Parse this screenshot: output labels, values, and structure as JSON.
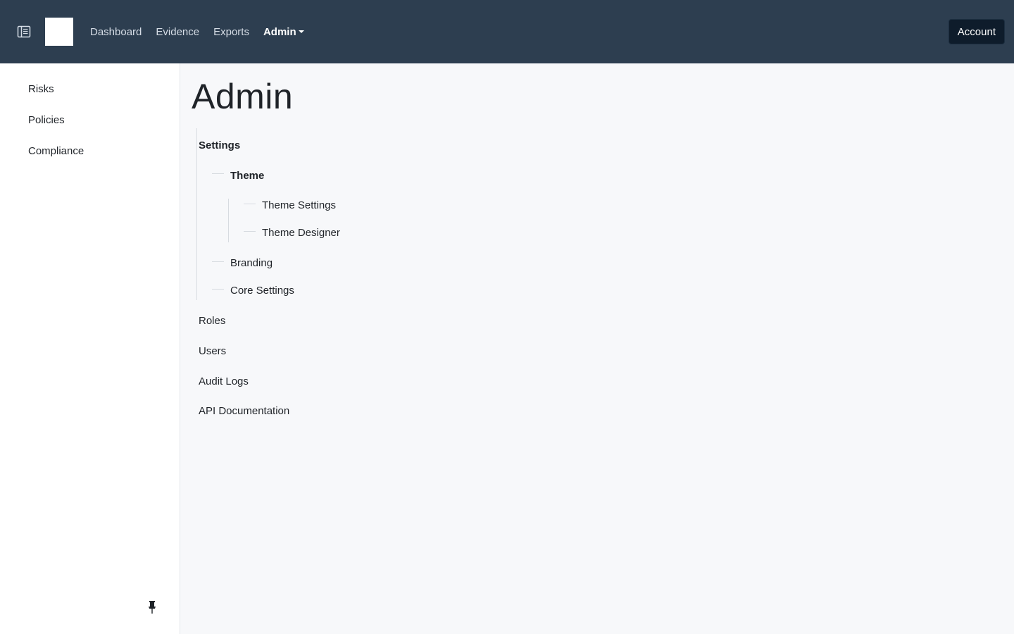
{
  "navbar": {
    "links": [
      {
        "label": "Dashboard"
      },
      {
        "label": "Evidence"
      },
      {
        "label": "Exports"
      },
      {
        "label": "Admin"
      }
    ],
    "account_label": "Account",
    "active_link": "Admin"
  },
  "sidebar": {
    "items": [
      {
        "label": "Risks"
      },
      {
        "label": "Policies"
      },
      {
        "label": "Compliance"
      }
    ]
  },
  "main": {
    "title": "Admin",
    "tree": {
      "settings": "Settings",
      "theme": "Theme",
      "theme_settings": "Theme Settings",
      "theme_designer": "Theme Designer",
      "branding": "Branding",
      "core_settings": "Core Settings",
      "roles": "Roles",
      "users": "Users",
      "audit_logs": "Audit Logs",
      "api_documentation": "API Documentation"
    }
  },
  "icons": {
    "sidebar_toggle": "sidebar-toggle-icon",
    "pin": "pin-icon",
    "dropdown": "caret-down-icon"
  },
  "colors": {
    "navbar_bg": "#2d3e50",
    "account_bg": "#0e1c2b",
    "page_bg": "#f7f8fa",
    "sidebar_bg": "#ffffff"
  }
}
